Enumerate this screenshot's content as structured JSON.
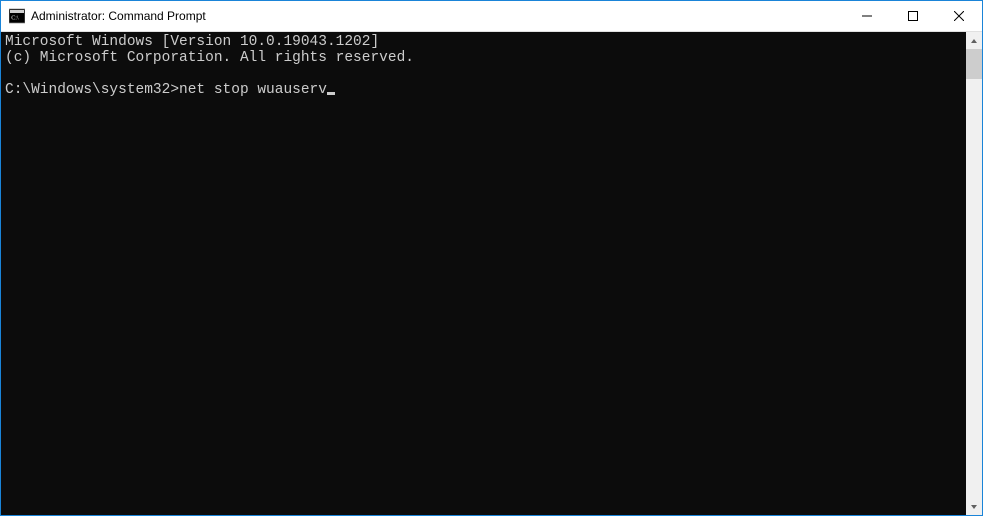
{
  "titlebar": {
    "title": "Administrator: Command Prompt"
  },
  "terminal": {
    "line1": "Microsoft Windows [Version 10.0.19043.1202]",
    "line2": "(c) Microsoft Corporation. All rights reserved.",
    "blank": "",
    "prompt": "C:\\Windows\\system32>",
    "command": "net stop wuauserv"
  }
}
